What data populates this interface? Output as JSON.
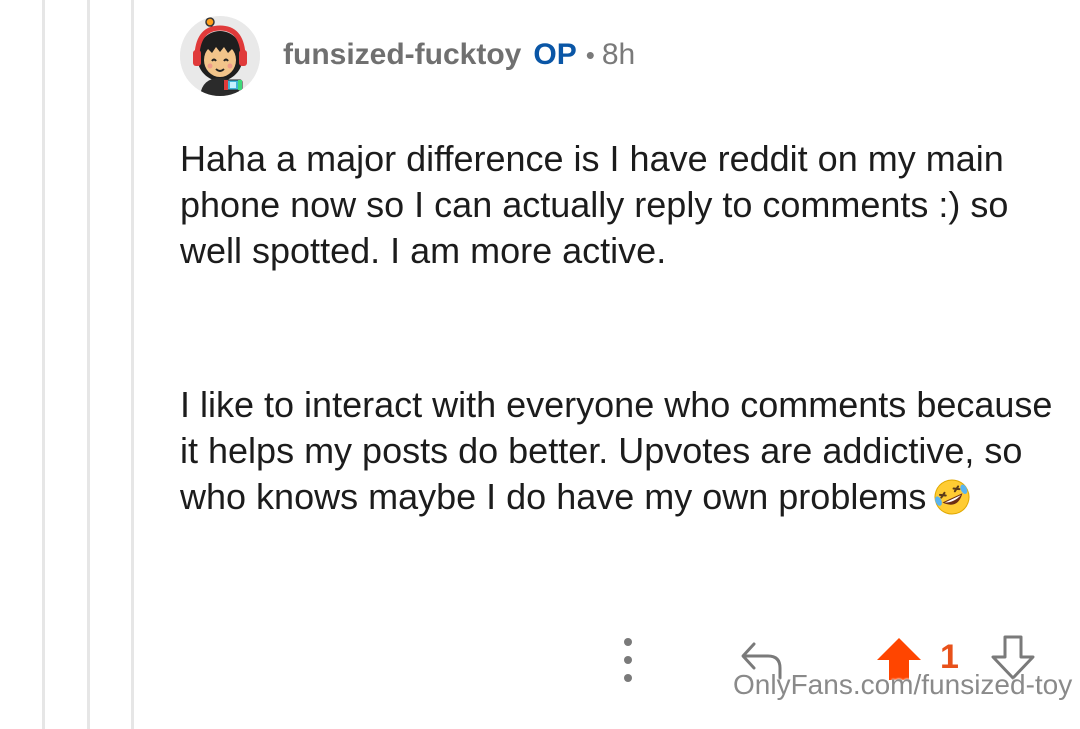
{
  "comment": {
    "author": "funsized-fucktoy",
    "op_badge": "OP",
    "separator": "•",
    "time_ago": "8h",
    "avatar_icon": "cartoon-avatar-icon",
    "paragraphs": [
      "Haha a major difference is I have reddit on my main phone now so I can actually reply to comments :) so well spotted. I am more active.",
      "I like to interact with everyone who comments because it helps my posts do better. Upvotes are addictive, so who knows maybe I do have my own problems"
    ],
    "emoji": "rolling-on-floor-laughing-emoji"
  },
  "actions": {
    "more_icon": "more-vertical-icon",
    "reply_icon": "reply-arrow-icon",
    "upvote_icon": "upvote-arrow-icon",
    "downvote_icon": "downvote-arrow-icon",
    "vote_count": "1",
    "upvote_state": "active"
  },
  "watermark": "OnlyFans.com/funsized-toy",
  "colors": {
    "upvote_active": "#ff4500",
    "vote_count": "#e8511a",
    "op_badge": "#0a56a6",
    "username": "#707070",
    "body_text": "#1c1c1c"
  }
}
